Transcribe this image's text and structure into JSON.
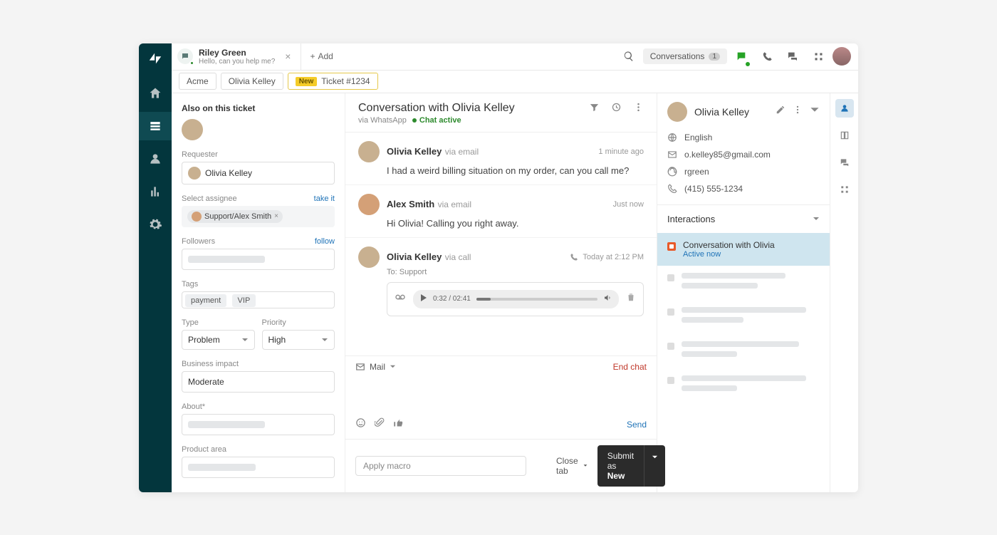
{
  "topbar": {
    "tab_name": "Riley Green",
    "tab_sub": "Hello, can you help me?",
    "add_label": "Add",
    "conversations_label": "Conversations",
    "conversations_count": "1"
  },
  "breadcrumbs": {
    "b1": "Acme",
    "b2": "Olivia Kelley",
    "pill": "New",
    "ticket": "Ticket #1234"
  },
  "left": {
    "header": "Also on this ticket",
    "requester_label": "Requester",
    "requester_value": "Olivia Kelley",
    "assignee_label": "Select assignee",
    "take_it": "take it",
    "assignee_value": "Support/Alex Smith",
    "followers_label": "Followers",
    "follow": "follow",
    "tags_label": "Tags",
    "tag1": "payment",
    "tag2": "VIP",
    "type_label": "Type",
    "type_value": "Problem",
    "priority_label": "Priority",
    "priority_value": "High",
    "impact_label": "Business impact",
    "impact_value": "Moderate",
    "about_label": "About*",
    "product_label": "Product area"
  },
  "center": {
    "title": "Conversation with Olivia Kelley",
    "via": "via WhatsApp",
    "chat_active": "Chat active",
    "m1_name": "Olivia Kelley",
    "m1_via": "via email",
    "m1_time": "1 minute ago",
    "m1_body": "I had a weird billing situation on my order, can you call me?",
    "m2_name": "Alex Smith",
    "m2_via": "via email",
    "m2_time": "Just now",
    "m2_body": "Hi Olivia! Calling you right away.",
    "m3_name": "Olivia Kelley",
    "m3_via": "via call",
    "m3_time": "Today at 2:12 PM",
    "m3_to": "To: Support",
    "audio_time": "0:32 / 02:41",
    "compose_channel": "Mail",
    "end_chat": "End chat",
    "send": "Send",
    "macro_placeholder": "Apply macro",
    "close_tab": "Close tab",
    "submit_prefix": "Submit as ",
    "submit_status": "New"
  },
  "right": {
    "name": "Olivia Kelley",
    "lang": "English",
    "email": "o.kelley85@gmail.com",
    "handle": "rgreen",
    "phone": "(415) 555-1234",
    "interactions_label": "Interactions",
    "active_title": "Conversation with Olivia",
    "active_sub": "Active now"
  }
}
